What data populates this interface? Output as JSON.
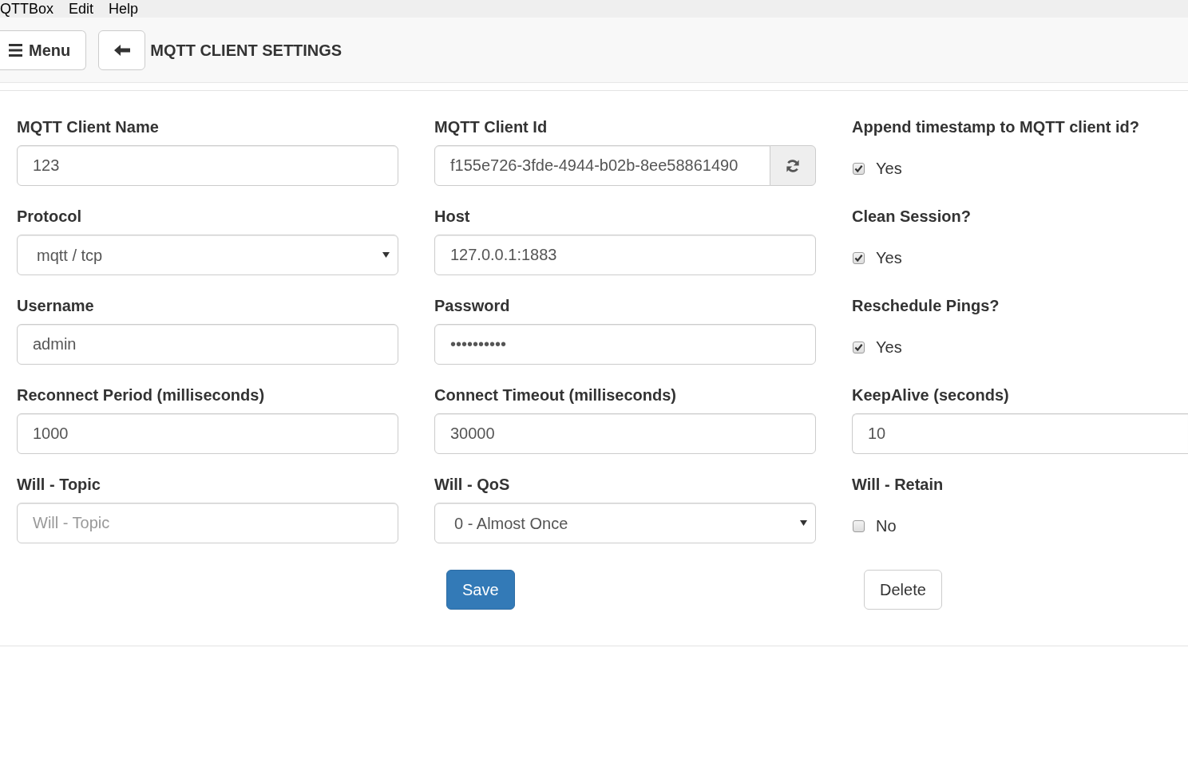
{
  "menu_bar": [
    "QTTBox",
    "Edit",
    "Help"
  ],
  "header": {
    "menu_button": "Menu",
    "title": "MQTT CLIENT SETTINGS"
  },
  "fields": [
    {
      "label": "MQTT Client Name",
      "kind": "text",
      "value": "123"
    },
    {
      "label": "MQTT Client Id",
      "kind": "text_with_button",
      "value": "f155e726-3fde-4944-b02b-8ee58861490"
    },
    {
      "label": "Append timestamp to MQTT client id?",
      "kind": "checkbox",
      "checked": true,
      "option": "Yes"
    },
    {
      "label": "Protocol",
      "kind": "select",
      "value": "mqtt / tcp"
    },
    {
      "label": "Host",
      "kind": "text",
      "value": "127.0.0.1:1883"
    },
    {
      "label": "Clean Session?",
      "kind": "checkbox",
      "checked": true,
      "option": "Yes"
    },
    {
      "label": "Username",
      "kind": "text",
      "value": "admin"
    },
    {
      "label": "Password",
      "kind": "password",
      "value": "••••••••••"
    },
    {
      "label": "Reschedule Pings?",
      "kind": "checkbox",
      "checked": true,
      "option": "Yes"
    },
    {
      "label": "Reconnect Period (milliseconds)",
      "kind": "text",
      "value": "1000"
    },
    {
      "label": "Connect Timeout (milliseconds)",
      "kind": "text",
      "value": "30000"
    },
    {
      "label": "KeepAlive (seconds)",
      "kind": "text",
      "value": "10"
    },
    {
      "label": "Will - Topic",
      "kind": "text",
      "placeholder": "Will - Topic"
    },
    {
      "label": "Will - QoS",
      "kind": "select",
      "value": "0 - Almost Once"
    },
    {
      "label": "Will - Retain",
      "kind": "checkbox",
      "checked": false,
      "option": "No"
    }
  ],
  "buttons": [
    {
      "label": "Save",
      "kind": "primary"
    },
    {
      "label": "Delete",
      "kind": "default"
    }
  ]
}
